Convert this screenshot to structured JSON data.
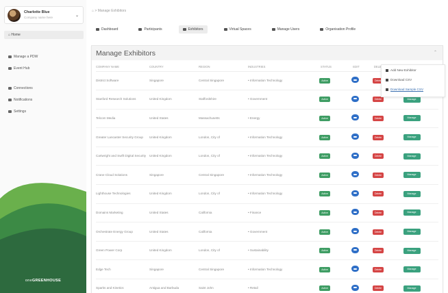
{
  "sidebar": {
    "profile_name": "Charlotte Blue",
    "profile_sub": "Company name here",
    "home_label": "Home",
    "items": [
      {
        "label": "Manage a PDW"
      },
      {
        "label": "Event Hub"
      },
      {
        "label": "Connections"
      },
      {
        "label": "Notifications"
      },
      {
        "label": "Settings"
      }
    ],
    "logo_prefix": "one",
    "logo_brand": "GREENHOUSE",
    "colors": {
      "green_dark": "#2d6a3e",
      "green_light": "#6ab04c"
    }
  },
  "breadcrumb": "Manage Exhibitors",
  "tabs": [
    {
      "label": "Dashboard"
    },
    {
      "label": "Participants"
    },
    {
      "label": "Exhibitors"
    },
    {
      "label": "Virtual Spaces"
    },
    {
      "label": "Manage Users"
    },
    {
      "label": "Organisation Profile"
    }
  ],
  "panel": {
    "title": "Manage Exhibitors",
    "collapse_icon": "chevron-up-icon"
  },
  "table": {
    "headers": [
      "COMPANY NAME",
      "COUNTRY",
      "REGION",
      "INDUSTRIES",
      "STATUS",
      "EDIT",
      "DELETE",
      ""
    ],
    "rows": [
      {
        "company": "District Software",
        "country": "Singapore",
        "region": "Central Singapore",
        "industries": "• Information Technology"
      },
      {
        "company": "Stanford Research Solutions",
        "country": "United Kingdom",
        "region": "Staffordshire",
        "industries": "• Government"
      },
      {
        "company": "Telcom Media",
        "country": "United States",
        "region": "Massachusetts",
        "industries": "• Energy"
      },
      {
        "company": "Greater Lancaster Security Group",
        "country": "United Kingdom",
        "region": "London, City of",
        "industries": "• Information Technology"
      },
      {
        "company": "Cartwright and Swift Digital Security",
        "country": "United Kingdom",
        "region": "London, City of",
        "industries": "• Information Technology"
      },
      {
        "company": "Crane Cloud Solutions",
        "country": "Singapore",
        "region": "Central Singapore",
        "industries": "• Information Technology"
      },
      {
        "company": "Lighthouse Technologies",
        "country": "United Kingdom",
        "region": "London, City of",
        "industries": "• Information Technology"
      },
      {
        "company": "Domains Marketing",
        "country": "United States",
        "region": "California",
        "industries": "• Finance"
      },
      {
        "company": "Orchestrate Energy Group",
        "country": "United States",
        "region": "California",
        "industries": "• Government"
      },
      {
        "company": "Green Power Corp",
        "country": "United Kingdom",
        "region": "London, City of",
        "industries": "• Sustainability"
      },
      {
        "company": "Edge Tech",
        "country": "Singapore",
        "region": "Central Singapore",
        "industries": "• Information Technology"
      },
      {
        "company": "Sparks and Kinetics",
        "country": "Antigua and Barbuda",
        "region": "Saint John",
        "industries": "• Retail"
      }
    ],
    "status_label": "Active",
    "edit_icon": "edit-icon",
    "delete_label": "Delete",
    "manage_label": "Manage"
  },
  "dropdown": {
    "items": [
      {
        "label": "Add New Exhibitor"
      },
      {
        "label": "Download CSV"
      },
      {
        "label": "Download Sample CSV"
      }
    ]
  }
}
